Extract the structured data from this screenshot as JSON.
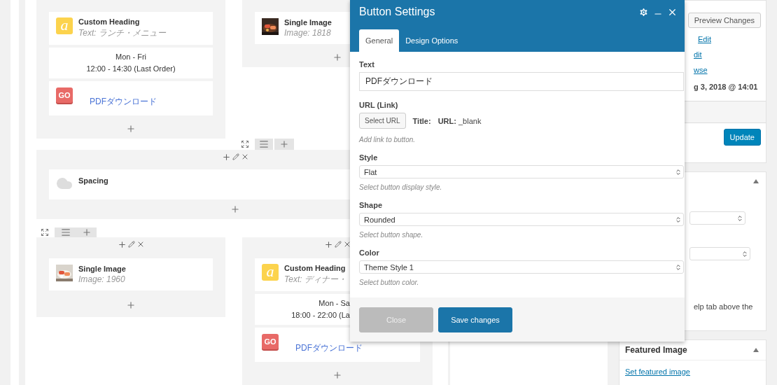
{
  "builder": {
    "rows": [
      {
        "kind": "columns",
        "toolbar": false,
        "columns": [
          {
            "controls": false,
            "elements": [
              {
                "kind": "heading",
                "icon": "a",
                "title": "Custom Heading",
                "subtitle": "Text: ランチ・メニュー"
              },
              {
                "kind": "text",
                "lines": [
                  "Mon - Fri",
                  "12:00 - 14:30 (Last Order)"
                ]
              },
              {
                "kind": "button",
                "badge": "GO",
                "label": "PDFダウンロード"
              }
            ]
          },
          {
            "controls": false,
            "elements": [
              {
                "title": "Single Image",
                "subtitle": "Image: 1818"
              }
            ]
          }
        ]
      },
      {
        "kind": "full",
        "toolbar": true,
        "elements": [
          {
            "kind": "spacing",
            "title": "Spacing"
          }
        ]
      },
      {
        "kind": "columns",
        "toolbar": true,
        "columns": [
          {
            "controls": true,
            "elements": [
              {
                "title": "Single Image",
                "subtitle": "Image: 1960"
              }
            ]
          },
          {
            "controls": true,
            "elements": [
              {
                "kind": "heading",
                "icon": "a",
                "title": "Custom Heading",
                "subtitle": "Text: ディナー・"
              },
              {
                "kind": "text",
                "lines": [
                  "Mon - Sa",
                  "18:00 - 22:00 (La"
                ]
              },
              {
                "kind": "button",
                "badge": "GO",
                "label": "PDFダウンロード"
              }
            ]
          }
        ]
      }
    ]
  },
  "modal": {
    "title": "Button Settings",
    "tabs": [
      {
        "label": "General",
        "selected": true
      },
      {
        "label": "Design Options",
        "selected": false
      }
    ],
    "fields": [
      {
        "kind": "text",
        "label": "Text",
        "value": "PDFダウンロード"
      },
      {
        "kind": "url",
        "label": "URL (Link)",
        "button": "Select URL",
        "title_label": "Title:",
        "url_label": "URL:",
        "url_value": "_blank",
        "help": "Add link to button."
      },
      {
        "kind": "select",
        "label": "Style",
        "value": "Flat",
        "help": "Select button display style."
      },
      {
        "kind": "select",
        "label": "Shape",
        "value": "Rounded",
        "help": "Select button shape."
      },
      {
        "kind": "select",
        "label": "Color",
        "value": "Theme Style 1",
        "help": "Select button color."
      }
    ],
    "buttons": [
      {
        "label": "Close",
        "kind": "secondary"
      },
      {
        "label": "Save changes",
        "kind": "primary"
      }
    ]
  },
  "sidebar": {
    "publish": {
      "preview_button": "Preview Changes",
      "links": [
        "Edit",
        "dit",
        "wse"
      ],
      "date": "g 3, 2018 @ 14:01",
      "update_button": "Update"
    },
    "attributes": {
      "help_fragment": "elp tab above the"
    },
    "featured": {
      "title": "Featured Image",
      "link": "Set featured image"
    }
  }
}
